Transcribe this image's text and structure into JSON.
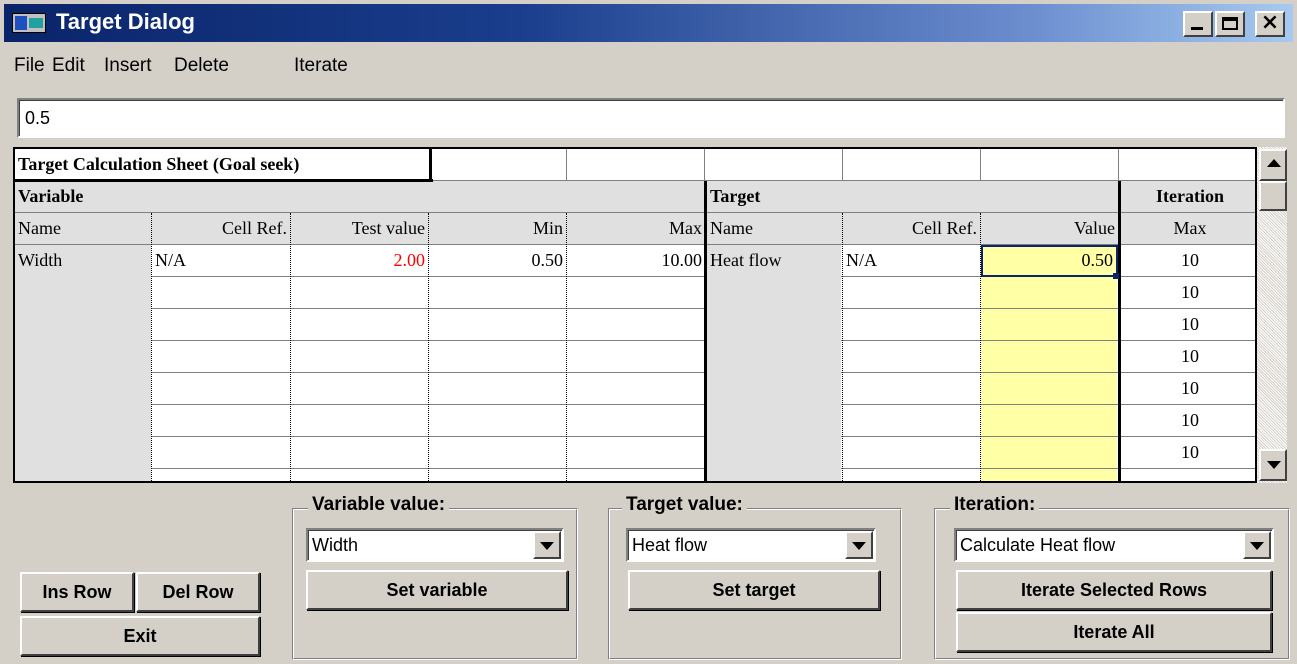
{
  "window": {
    "title": "Target Dialog"
  },
  "menu": [
    "File",
    "Edit",
    "Insert",
    "Delete",
    "Iterate"
  ],
  "formula_bar": {
    "value": "0.5"
  },
  "sheet": {
    "title": "Target Calculation Sheet (Goal seek)",
    "group_variable": "Variable",
    "group_target": "Target",
    "group_iteration": "Iteration",
    "columns": {
      "var_name": "Name",
      "var_cellref": "Cell Ref.",
      "var_test": "Test value",
      "var_min": "Min",
      "var_max": "Max",
      "tgt_name": "Name",
      "tgt_cellref": "Cell Ref.",
      "tgt_value": "Value",
      "iter_max": "Max"
    },
    "row1": {
      "var_name": "Width",
      "var_cellref": "N/A",
      "test_value": "2.00",
      "min": "0.50",
      "max": "10.00",
      "tgt_name": "Heat flow",
      "tgt_cellref": "N/A",
      "tgt_value": "0.50",
      "iter_max": "10"
    },
    "iter_max_more": [
      "10",
      "10",
      "10",
      "10",
      "10",
      "10"
    ]
  },
  "panels": {
    "variable": {
      "title": "Variable value:",
      "selected": "Width",
      "button": "Set variable"
    },
    "target": {
      "title": "Target value:",
      "selected": "Heat flow",
      "button": "Set target"
    },
    "iteration": {
      "title": "Iteration:",
      "selected": "Calculate Heat flow",
      "button_selected": "Iterate Selected Rows",
      "button_all": "Iterate All"
    }
  },
  "buttons": {
    "ins_row": "Ins Row",
    "del_row": "Del Row",
    "exit": "Exit"
  },
  "colors": {
    "title_bar": "#0a246a",
    "value_column": "#ffffa6",
    "test_value_text": "#ff0000"
  }
}
